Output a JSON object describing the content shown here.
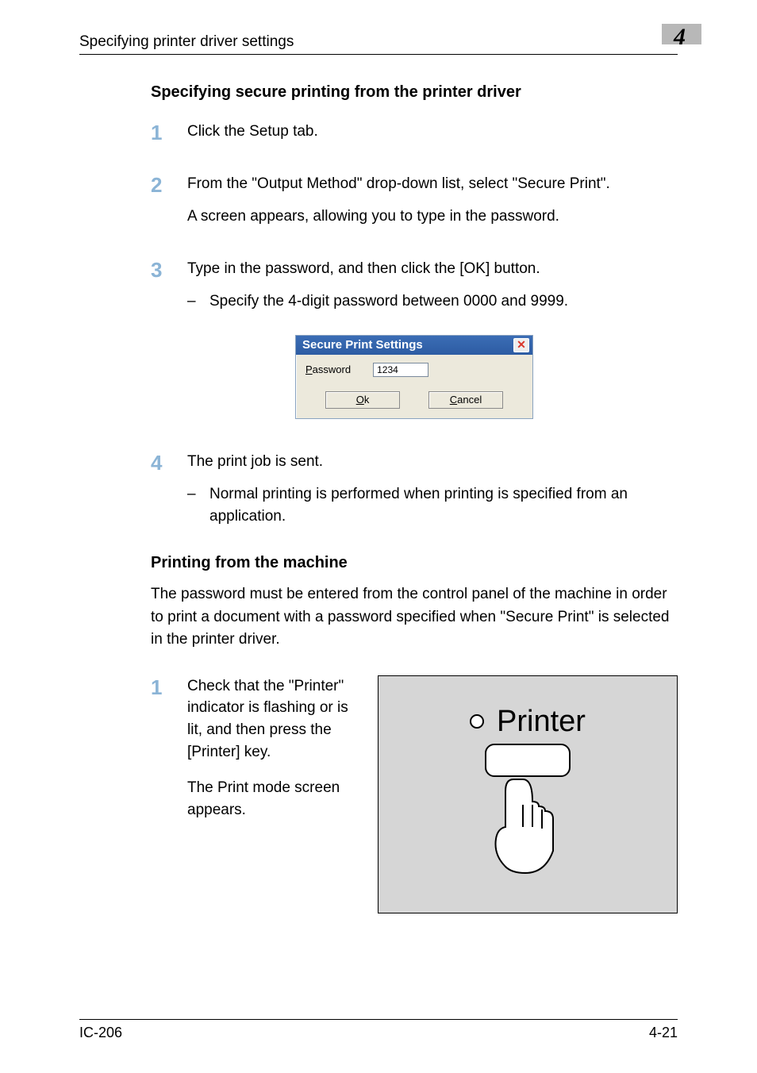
{
  "header": {
    "title": "Specifying printer driver settings",
    "chapter": "4"
  },
  "section1": {
    "heading": "Specifying secure printing from the printer driver",
    "steps": [
      {
        "num": "1",
        "paras": [
          "Click the Setup tab."
        ]
      },
      {
        "num": "2",
        "paras": [
          "From the \"Output Method\" drop-down list, select \"Secure Print\".",
          "A screen appears, allowing you to type in the password."
        ]
      },
      {
        "num": "3",
        "paras": [
          "Type in the password, and then click the [OK] button."
        ],
        "sub": "Specify the 4-digit password between 0000 and 9999."
      },
      {
        "num": "4",
        "paras": [
          "The print job is sent."
        ],
        "sub": "Normal printing is performed when printing is specified from an application."
      }
    ]
  },
  "dialog": {
    "title": "Secure Print Settings",
    "password_label": "Password",
    "password_value": "1234",
    "ok_label": "Ok",
    "cancel_label": "Cancel"
  },
  "section2": {
    "heading": "Printing from the machine",
    "intro": "The password must be entered from the control panel of the machine in order to print a document with a password specified when \"Secure Print\" is selected in the printer driver.",
    "step": {
      "num": "1",
      "para1": "Check that the \"Printer\" indicator is flashing or is lit, and then press the [Printer] key.",
      "para2": "The Print mode screen appears."
    },
    "figure": {
      "label": "Printer"
    }
  },
  "footer": {
    "left": "IC-206",
    "right": "4-21"
  }
}
